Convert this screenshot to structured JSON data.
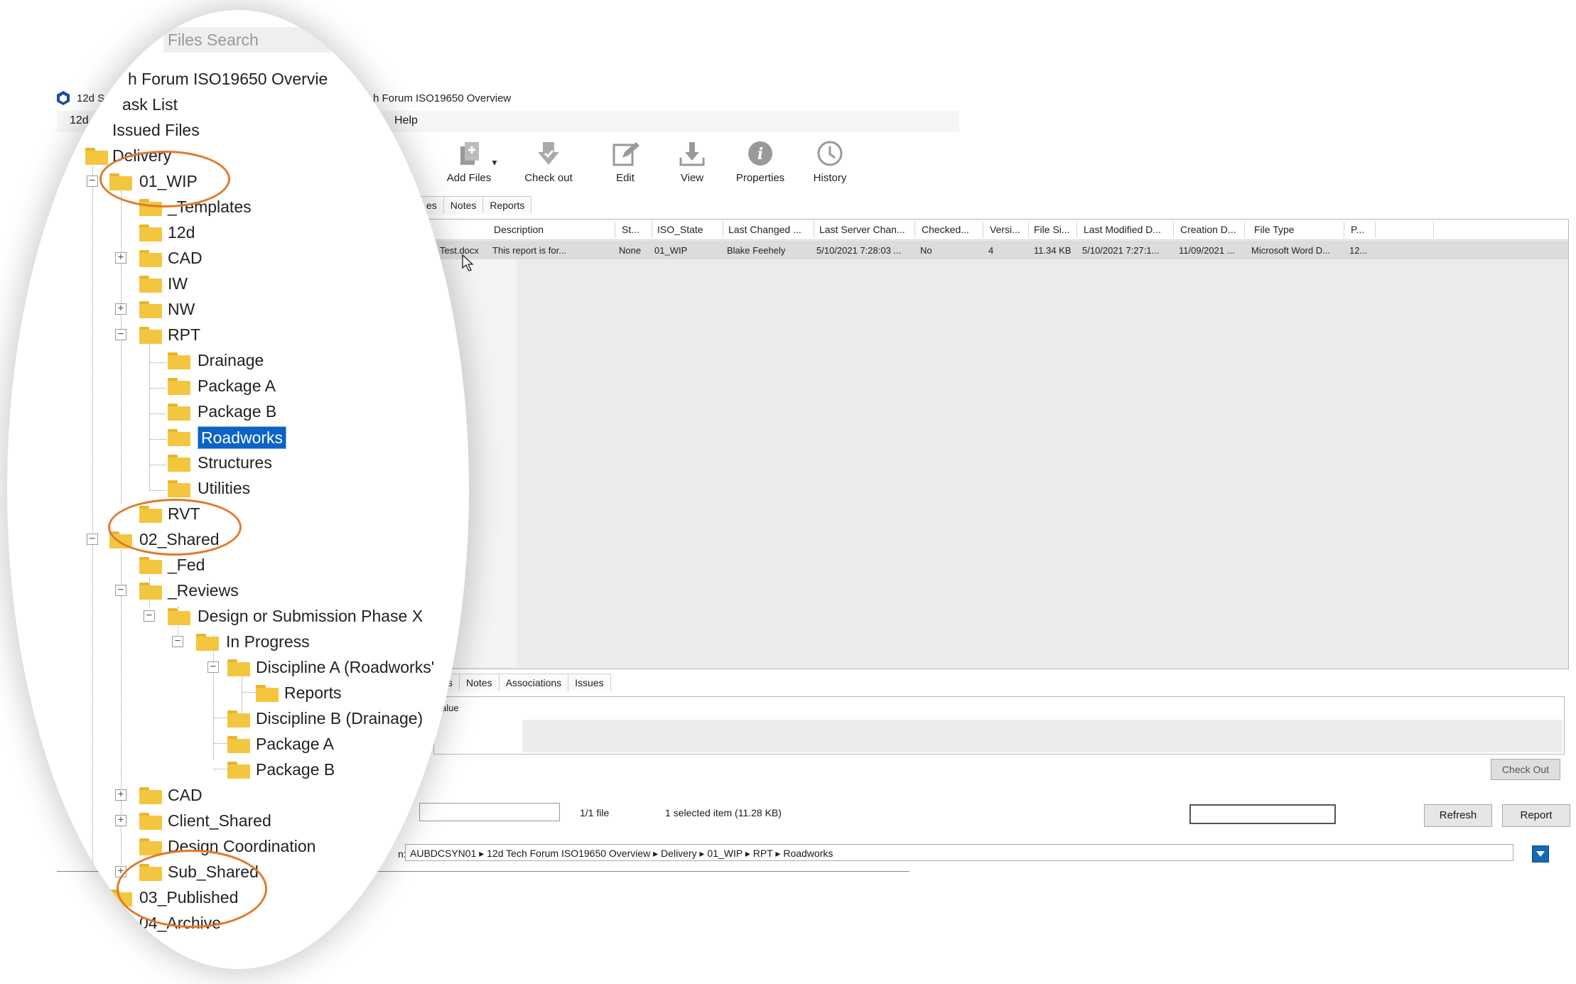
{
  "window": {
    "title_left": "12d S",
    "title_main": "h Forum ISO19650 Overview",
    "menu_left": "12d S",
    "menu_help": "Help"
  },
  "toolbar": {
    "add_files": "Add Files",
    "check_out": "Check out",
    "edit": "Edit",
    "view": "View",
    "properties": "Properties",
    "history": "History"
  },
  "top_tabs": [
    "es",
    "Notes",
    "Reports"
  ],
  "grid": {
    "columns": [
      "Description",
      "St...",
      "ISO_State",
      "Last Changed ...",
      "Last Server Chan...",
      "Checked...",
      "Versi...",
      "File Si...",
      "Last Modified D...",
      "Creation D...",
      "File Type",
      "P..."
    ],
    "row": {
      "name": "Test.docx",
      "description": "This report is for...",
      "status": "None",
      "iso_state": "01_WIP",
      "last_changed": "Blake Feehely",
      "last_server_change": "5/10/2021 7:28:03 ...",
      "checked": "No",
      "version": "4",
      "file_size": "11.34 KB",
      "last_modified": "5/10/2021 7:27:1...",
      "creation": "11/09/2021 ...",
      "file_type": "Microsoft Word D...",
      "p": "12..."
    }
  },
  "bottom_tabs": [
    "s",
    "Notes",
    "Associations",
    "Issues"
  ],
  "props": {
    "value_header": "alue",
    "checkout_btn": "Check Out"
  },
  "status": {
    "count": "1/1 file",
    "selection": "1 selected item (11.28 KB)",
    "refresh": "Refresh",
    "report": "Report"
  },
  "path": {
    "label": "n:",
    "value": "AUBDCSYN01 ▸ 12d Tech Forum ISO19650 Overview ▸ Delivery ▸ 01_WIP ▸ RPT ▸ Roadworks"
  },
  "tree": {
    "search_placeholder": "Files Search",
    "items": [
      "h Forum ISO19650 Overvie",
      "ask List",
      "Issued Files",
      "Delivery",
      "01_WIP",
      "_Templates",
      "12d",
      "CAD",
      "IW",
      "NW",
      "RPT",
      "Drainage",
      "Package A",
      "Package B",
      "Roadworks",
      "Structures",
      "Utilities",
      "RVT",
      "02_Shared",
      "_Fed",
      "_Reviews",
      "Design or Submission Phase X",
      "In Progress",
      "Discipline A (Roadworks'",
      "Reports",
      "Discipline B (Drainage)",
      "Package A",
      "Package B",
      "CAD",
      "Client_Shared",
      "Design Coordination",
      "Sub_Shared",
      "03_Published",
      "04_Archive"
    ]
  },
  "colors": {
    "highlight_ring": "#e07a2e",
    "selection": "#0a63c6",
    "folder": "#f3c640"
  }
}
